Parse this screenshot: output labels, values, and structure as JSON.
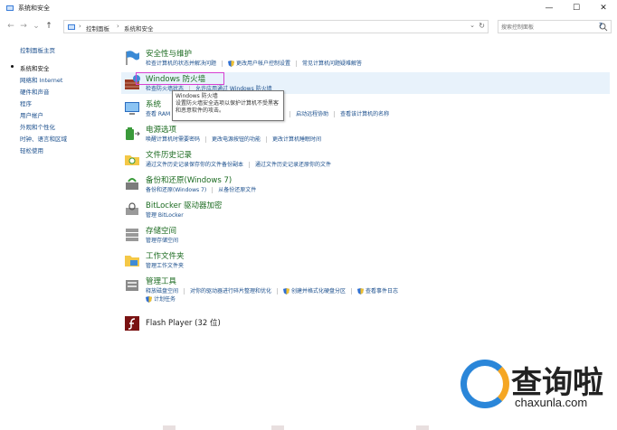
{
  "window": {
    "title": "系统和安全",
    "minimize": "—",
    "maximize": "☐",
    "close": "✕",
    "help": "?"
  },
  "address": {
    "crumbs": [
      "控制面板",
      "系统和安全"
    ],
    "search_placeholder": "搜索控制面板"
  },
  "sidebar": {
    "items": [
      {
        "label": "控制面板主页"
      },
      {
        "label": "系统和安全"
      },
      {
        "label": "网络和 Internet"
      },
      {
        "label": "硬件和声音"
      },
      {
        "label": "程序"
      },
      {
        "label": "用户帐户"
      },
      {
        "label": "外观和个性化"
      },
      {
        "label": "时钟、语言和区域"
      },
      {
        "label": "轻松使用"
      }
    ]
  },
  "categories": {
    "security": {
      "title": "安全性与维护",
      "links": [
        "检查计算机的状态并解决问题",
        "更改用户帐户控制设置",
        "常见计算机问题疑难解答"
      ]
    },
    "firewall": {
      "title": "Windows 防火墙",
      "links": [
        "检查防火墙状态",
        "允许应用通过 Windows 防火墙"
      ]
    },
    "system": {
      "title": "系统",
      "links": [
        "查看 RAM",
        "访问",
        "启动远程协助",
        "查看该计算机的名称"
      ]
    },
    "power": {
      "title": "电源选项",
      "links": [
        "唤醒计算机时需要密码",
        "更改电源按钮的功能",
        "更改计算机睡眠时间"
      ]
    },
    "history": {
      "title": "文件历史记录",
      "links": [
        "通过文件历史记录保存你的文件备份副本",
        "通过文件历史记录还原你的文件"
      ]
    },
    "backup": {
      "title": "备份和还原(Windows 7)",
      "links": [
        "备份和还原(Windows 7)",
        "从备份还原文件"
      ]
    },
    "bitlocker": {
      "title": "BitLocker 驱动器加密",
      "links": [
        "管理 BitLocker"
      ]
    },
    "storage": {
      "title": "存储空间",
      "links": [
        "管理存储空间"
      ]
    },
    "workfolders": {
      "title": "工作文件夹",
      "links": [
        "管理工作文件夹"
      ]
    },
    "admin": {
      "title": "管理工具",
      "links": [
        "释放磁盘空间",
        "对你的驱动器进行碎片整理和优化",
        "创建并格式化硬盘分区",
        "查看事件日志",
        "计划任务"
      ]
    },
    "flash": {
      "title": "Flash Player (32 位)"
    }
  },
  "tooltip": {
    "title": "Windows 防火墙",
    "body": "设置防火墙安全选项以保护计算机不受黑客和恶意软件的攻击。"
  },
  "watermark": {
    "cn": "查询啦",
    "en": "chaxunla.com"
  },
  "colors": {
    "title_green": "#1c6b21",
    "link_blue": "#1a4e8c",
    "highlight": "#e8f2fb",
    "annotation_pink": "#d63fd1"
  }
}
